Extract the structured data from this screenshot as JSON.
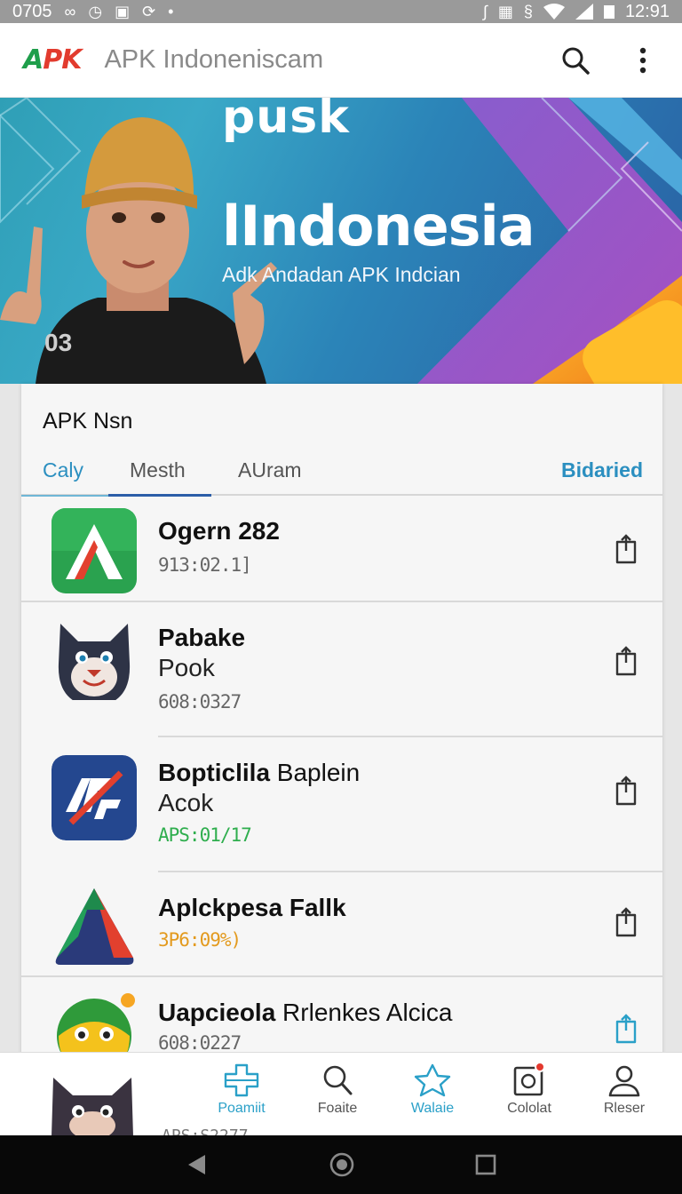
{
  "status_bar": {
    "left_text": "0705",
    "time": "12:91",
    "icons": [
      "link-icon",
      "alarm-icon",
      "download-icon",
      "sync-icon",
      "dot-icon",
      "bluetooth-icon",
      "vibrate-icon",
      "nfc-icon",
      "wifi-icon",
      "signal-icon",
      "battery-icon"
    ]
  },
  "app_bar": {
    "logo": {
      "a": "A",
      "pk": "PK"
    },
    "title": "APK Indoneniscam",
    "icons": [
      "search-icon",
      "more-vert-icon"
    ]
  },
  "banner": {
    "eyebrow": "pusk",
    "title": "lIndonesia",
    "subtitle": "Adk Andadan APK Indcian",
    "counter": "03"
  },
  "section": {
    "title": "APK Nsn",
    "tabs": [
      {
        "label": "Caly",
        "state": "selected"
      },
      {
        "label": "Mesth",
        "state": "underlined"
      },
      {
        "label": "AUram",
        "state": "normal"
      },
      {
        "label": "Bidaried",
        "state": "link"
      }
    ]
  },
  "apps": [
    {
      "name": "Ogern 282",
      "name_rest": "",
      "subtitle": "",
      "meta": "913:02.1]",
      "meta_color": "#666666",
      "icon": "letter-a-app-icon"
    },
    {
      "name": "Pabake",
      "name_rest": "",
      "subtitle": "Pook",
      "meta": "608:0327",
      "meta_color": "#666666",
      "icon": "cat-mascot-app-icon"
    },
    {
      "name": "Bopticlila",
      "name_rest": " Baplein",
      "subtitle": "Acok",
      "meta": "APS:01/17",
      "meta_color": "#2fae4e",
      "icon": "apk-shield-app-icon"
    },
    {
      "name": "Aplckpesa Fallk",
      "name_rest": "",
      "subtitle": "",
      "meta": "3P6:09%)",
      "meta_color": "#e39a1e",
      "icon": "triangle-app-icon"
    },
    {
      "name": "Uapcieola",
      "name_rest": " Rrlenkes Alcica",
      "subtitle": "",
      "meta": "608:0227",
      "meta_color": "#666666",
      "icon": "bird-app-icon"
    }
  ],
  "bottom_nav": {
    "peek_text": "APS:S2277",
    "items": [
      {
        "label": "Poamiit",
        "icon": "apps-plus-icon",
        "active": true
      },
      {
        "label": "Foaite",
        "icon": "search-icon",
        "active": false
      },
      {
        "label": "Walaie",
        "icon": "star-icon",
        "active": true
      },
      {
        "label": "Cololat",
        "icon": "notification-box-icon",
        "active": false,
        "badge": true
      },
      {
        "label": "Rleser",
        "icon": "person-icon",
        "active": false
      }
    ]
  },
  "colors": {
    "accent": "#2aa0c8",
    "tab_underline": "#2c5ea8",
    "logo_green": "#1f9e4b",
    "logo_red": "#e23b2e",
    "badge": "#e4392e"
  }
}
